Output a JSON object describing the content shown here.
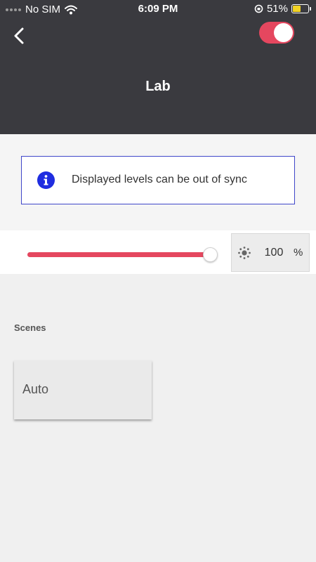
{
  "status_bar": {
    "carrier": "No SIM",
    "time": "6:09 PM",
    "battery_percent": "51%",
    "battery_level": 0.51
  },
  "header": {
    "title": "Lab",
    "power_on": true,
    "accent_color": "#e5475f",
    "background_color": "#3a3a3f"
  },
  "notice": {
    "text": "Displayed levels can be out of sync",
    "icon": "info-icon",
    "border_color": "#3f46c9"
  },
  "brightness": {
    "level": 100,
    "value_text": "100",
    "unit": "%",
    "icon": "brightness-icon"
  },
  "scenes": {
    "label": "Scenes",
    "items": [
      {
        "label": "Auto"
      }
    ]
  }
}
